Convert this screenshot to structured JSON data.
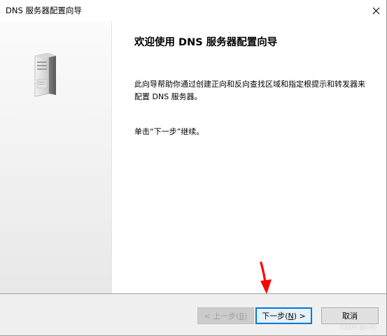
{
  "window": {
    "title": "DNS 服务器配置向导"
  },
  "content": {
    "heading": "欢迎使用 DNS 服务器配置向导",
    "description": "此向导帮助你通过创建正向和反向查找区域和指定根提示和转发器来配置 DNS 服务器。",
    "instruction": "单击“下一步”继续。"
  },
  "buttons": {
    "back": {
      "prefix": "< 上一步(",
      "mnemonic": "B",
      "suffix": ")"
    },
    "next": {
      "prefix": "下一步(",
      "mnemonic": "N",
      "suffix": ") >"
    },
    "cancel": "取消"
  },
  "watermark": "CSDN @X40",
  "icons": {
    "close": "close-icon",
    "server": "server-icon",
    "annotation": "red-arrow-annotation"
  },
  "colors": {
    "focus_border": "#0078d7",
    "annotation": "#ff0000"
  }
}
